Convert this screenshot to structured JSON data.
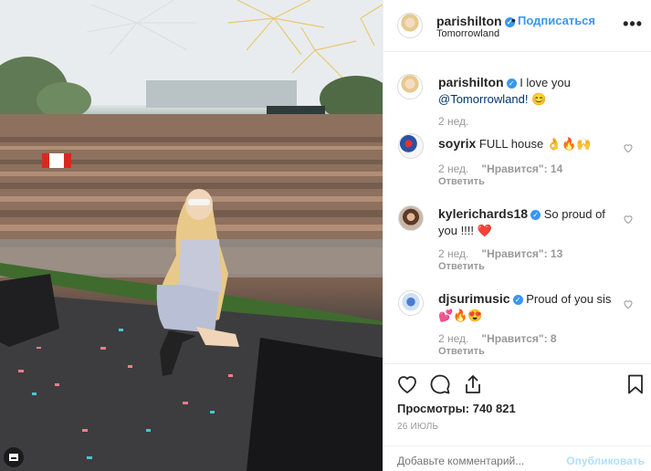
{
  "post": {
    "author": "parishilton",
    "follow_label": "Подписаться",
    "dot": "•",
    "location": "Tomorrowland",
    "more_label": "•••",
    "verified_mark": "✓",
    "caption_text": "I love you",
    "caption_mention": "@Tomorrowland!",
    "caption_emoji": "😊",
    "caption_time": "2 нед.",
    "views_label": "Просмотры:",
    "views_count": "740 821",
    "date": "26 ИЮЛЬ",
    "add_comment_placeholder": "Добавьте комментарий...",
    "publish_label": "Опубликовать"
  },
  "comments": [
    {
      "user": "soyrix",
      "text": "FULL house 👌🔥🙌",
      "time": "2 нед.",
      "likes": "\"Нравится\": 14",
      "reply": "Ответить"
    },
    {
      "user": "kylerichards18",
      "text": "So proud of you !!!! ❤️",
      "time": "2 нед.",
      "likes": "\"Нравится\": 13",
      "reply": "Ответить"
    },
    {
      "user": "djsurimusic",
      "text": "Proud of you sis 💕🔥😍",
      "time": "2 нед.",
      "likes": "\"Нравится\": 8",
      "reply": "Ответить"
    }
  ],
  "icons": {
    "like": "heart-icon",
    "comment": "comment-icon",
    "share": "share-icon",
    "save": "bookmark-icon"
  },
  "colors": {
    "accent": "#3897f0",
    "mention": "#003569",
    "muted": "#999999",
    "publish_disabled": "#b2dffc"
  }
}
